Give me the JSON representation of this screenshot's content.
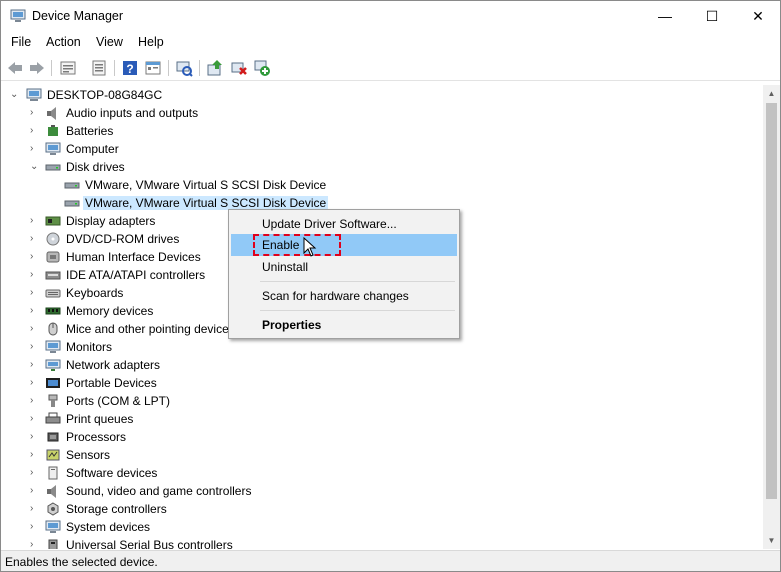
{
  "window": {
    "title": "Device Manager",
    "minimize_glyph": "—",
    "maximize_glyph": "☐",
    "close_glyph": "✕"
  },
  "menubar": [
    "File",
    "Action",
    "View",
    "Help"
  ],
  "toolbar_icons": [
    "back-icon",
    "forward-icon",
    "properties-icon",
    "update-driver-icon",
    "help-icon",
    "show-hidden-icon",
    "scan-hardware-icon",
    "update-driver-software-icon",
    "uninstall-icon",
    "enable-device-icon"
  ],
  "tree": {
    "root": "DESKTOP-08G84GC",
    "categories": [
      {
        "label": "Audio inputs and outputs",
        "expanded": false,
        "icon": "speaker-icon"
      },
      {
        "label": "Batteries",
        "expanded": false,
        "icon": "battery-icon"
      },
      {
        "label": "Computer",
        "expanded": false,
        "icon": "monitor-icon"
      },
      {
        "label": "Disk drives",
        "expanded": true,
        "icon": "disk-icon"
      },
      {
        "label": "Display adapters",
        "expanded": false,
        "icon": "display-adapter-icon"
      },
      {
        "label": "DVD/CD-ROM drives",
        "expanded": false,
        "icon": "dvd-icon"
      },
      {
        "label": "Human Interface Devices",
        "expanded": false,
        "icon": "hid-icon"
      },
      {
        "label": "IDE ATA/ATAPI controllers",
        "expanded": false,
        "icon": "ide-icon"
      },
      {
        "label": "Keyboards",
        "expanded": false,
        "icon": "keyboard-icon"
      },
      {
        "label": "Memory devices",
        "expanded": false,
        "icon": "memory-icon"
      },
      {
        "label": "Mice and other pointing devices",
        "expanded": false,
        "icon": "mouse-icon"
      },
      {
        "label": "Monitors",
        "expanded": false,
        "icon": "monitor-icon"
      },
      {
        "label": "Network adapters",
        "expanded": false,
        "icon": "network-icon"
      },
      {
        "label": "Portable Devices",
        "expanded": false,
        "icon": "portable-device-icon"
      },
      {
        "label": "Ports (COM & LPT)",
        "expanded": false,
        "icon": "port-icon"
      },
      {
        "label": "Print queues",
        "expanded": false,
        "icon": "printer-icon"
      },
      {
        "label": "Processors",
        "expanded": false,
        "icon": "processor-icon"
      },
      {
        "label": "Sensors",
        "expanded": false,
        "icon": "sensor-icon"
      },
      {
        "label": "Software devices",
        "expanded": false,
        "icon": "software-device-icon"
      },
      {
        "label": "Sound, video and game controllers",
        "expanded": false,
        "icon": "sound-icon"
      },
      {
        "label": "Storage controllers",
        "expanded": false,
        "icon": "storage-icon"
      },
      {
        "label": "System devices",
        "expanded": false,
        "icon": "system-icon"
      },
      {
        "label": "Universal Serial Bus controllers",
        "expanded": false,
        "icon": "usb-icon"
      }
    ],
    "disk_children": [
      {
        "label": "VMware, VMware Virtual S SCSI Disk Device",
        "selected": false
      },
      {
        "label": "VMware, VMware Virtual S SCSI Disk Device",
        "selected": true
      }
    ]
  },
  "context_menu": {
    "items": [
      {
        "label": "Update Driver Software...",
        "highlighted": false,
        "bold": false
      },
      {
        "label": "Enable",
        "highlighted": true,
        "bold": false
      },
      {
        "label": "Uninstall",
        "highlighted": false,
        "bold": false
      },
      {
        "label": "Scan for hardware changes",
        "highlighted": false,
        "bold": false
      },
      {
        "label": "Properties",
        "highlighted": false,
        "bold": true
      }
    ]
  },
  "status": "Enables the selected device.",
  "colors": {
    "selection": "#cce8ff",
    "menu_highlight": "#91c9f7",
    "annotation": "#e0001b"
  }
}
